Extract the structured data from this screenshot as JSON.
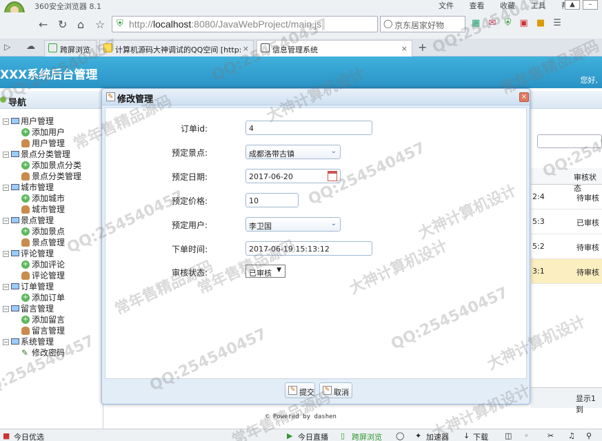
{
  "browser": {
    "app_title": "360安全浏览器 8.1",
    "menus": [
      "文件",
      "查看",
      "收藏",
      "工具",
      "帮助"
    ],
    "url_prefix": "http://",
    "url_host": "localhost",
    "url_rest": ":8080/JavaWebProject/main.js",
    "search_placeholder": "京东居家好物",
    "tabs": [
      {
        "label": "跨屏浏览"
      },
      {
        "label": "计算机源码大神调试的QQ空间 [http:"
      },
      {
        "label": "信息管理系统"
      }
    ]
  },
  "header": {
    "system_title": "XXX系统后台管理",
    "greeting": "您好,"
  },
  "nav": {
    "title": "导航",
    "groups": [
      {
        "label": "用户管理",
        "items": [
          {
            "label": "添加用户",
            "icon": "add"
          },
          {
            "label": "用户管理",
            "icon": "user"
          }
        ]
      },
      {
        "label": "景点分类管理",
        "items": [
          {
            "label": "添加景点分类",
            "icon": "add"
          },
          {
            "label": "景点分类管理",
            "icon": "user"
          }
        ]
      },
      {
        "label": "城市管理",
        "items": [
          {
            "label": "添加城市",
            "icon": "add"
          },
          {
            "label": "城市管理",
            "icon": "user"
          }
        ]
      },
      {
        "label": "景点管理",
        "items": [
          {
            "label": "添加景点",
            "icon": "add"
          },
          {
            "label": "景点管理",
            "icon": "user"
          }
        ]
      },
      {
        "label": "评论管理",
        "items": [
          {
            "label": "添加评论",
            "icon": "add"
          },
          {
            "label": "评论管理",
            "icon": "user"
          }
        ]
      },
      {
        "label": "订单管理",
        "items": [
          {
            "label": "添加订单",
            "icon": "add"
          },
          {
            "label": "订单管理",
            "icon": "user",
            "selected": true
          }
        ]
      },
      {
        "label": "留言管理",
        "items": [
          {
            "label": "添加留言",
            "icon": "add"
          },
          {
            "label": "留言管理",
            "icon": "user"
          }
        ]
      },
      {
        "label": "系统管理",
        "items": [
          {
            "label": "修改密码",
            "icon": "pen"
          }
        ]
      }
    ]
  },
  "grid": {
    "column_header": "审核状态",
    "rows": [
      {
        "time_tail": "2:4",
        "status": "待审核"
      },
      {
        "time_tail": "5:3",
        "status": "已审核"
      },
      {
        "time_tail": "5:2",
        "status": "待审核"
      },
      {
        "time_tail": "3:1",
        "status": "待审核"
      }
    ],
    "footer": "显示1到"
  },
  "modal": {
    "title": "修改管理",
    "fields": {
      "order_id": {
        "label": "订单id:",
        "value": "4"
      },
      "spot": {
        "label": "预定景点:",
        "value": "成都洛带古镇"
      },
      "date": {
        "label": "预定日期:",
        "value": "2017-06-20"
      },
      "price": {
        "label": "预定价格:",
        "value": "10"
      },
      "user": {
        "label": "预定用户:",
        "value": "李卫国"
      },
      "order_time": {
        "label": "下单时间:",
        "value": "2017-06-19 15:13:12"
      },
      "review": {
        "label": "审核状态:",
        "value": "已审核"
      }
    },
    "submit_label": "提交",
    "cancel_label": "取消"
  },
  "powered_by": "© Powered by dashen",
  "statusbar": {
    "left": "今日优选",
    "live": "今日直播",
    "crossscreen": "跨屏浏览",
    "accelerate": "加速器",
    "download": "下载"
  },
  "watermarks": [
    "QQ:254540457",
    "常年售精品源码",
    "大神计算机设计"
  ]
}
